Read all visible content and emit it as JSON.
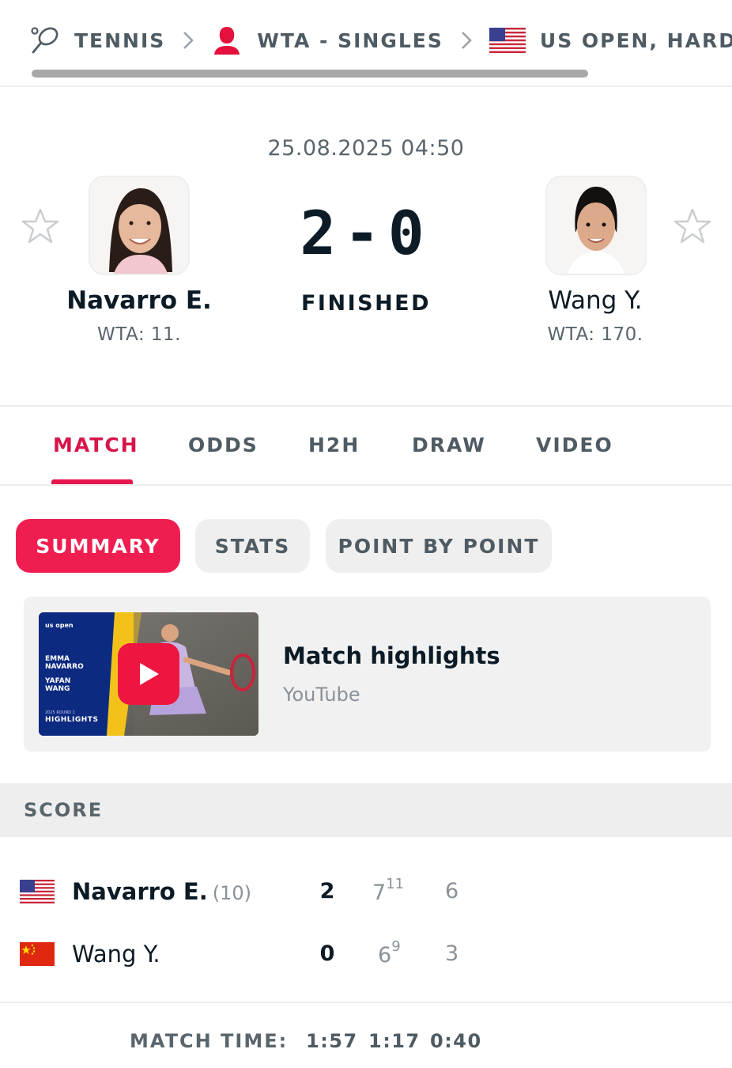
{
  "breadcrumb": {
    "sport": "TENNIS",
    "category": "WTA - SINGLES",
    "tournament": "US OPEN, HARD -"
  },
  "match": {
    "datetime": "25.08.2025 04:50",
    "score": "2-0",
    "status": "FINISHED",
    "home": {
      "name": "Navarro E.",
      "rank": "WTA: 11."
    },
    "away": {
      "name": "Wang Y.",
      "rank": "WTA: 170."
    }
  },
  "tabs": [
    "MATCH",
    "ODDS",
    "H2H",
    "DRAW",
    "VIDEO"
  ],
  "active_tab": "MATCH",
  "subtabs": [
    "SUMMARY",
    "STATS",
    "POINT BY POINT"
  ],
  "active_subtab": "SUMMARY",
  "highlights": {
    "title": "Match highlights",
    "source": "YouTube",
    "thumb": {
      "brand": "us open",
      "player1": [
        "EMMA",
        "NAVARRO"
      ],
      "player2": [
        "YAFAN",
        "WANG"
      ],
      "round": "2025 ROUND 1",
      "label": "HIGHLIGHTS"
    }
  },
  "score_table": {
    "header": "SCORE",
    "rows": [
      {
        "flag": "us-flag",
        "name": "Navarro E.",
        "seed": "(10)",
        "total": "2",
        "set1": "7",
        "set1_tb": "11",
        "set2": "6"
      },
      {
        "flag": "china-flag",
        "name": "Wang Y.",
        "seed": "",
        "total": "0",
        "set1": "6",
        "set1_tb": "9",
        "set2": "3"
      }
    ]
  },
  "match_time": {
    "label": "MATCH TIME:",
    "total": "1:57",
    "set1": "1:17",
    "set2": "0:40"
  },
  "colors": {
    "accent": "#f01e50",
    "accent_text": "#d6154a",
    "text": "#0c1b26",
    "muted": "#5a656c"
  }
}
